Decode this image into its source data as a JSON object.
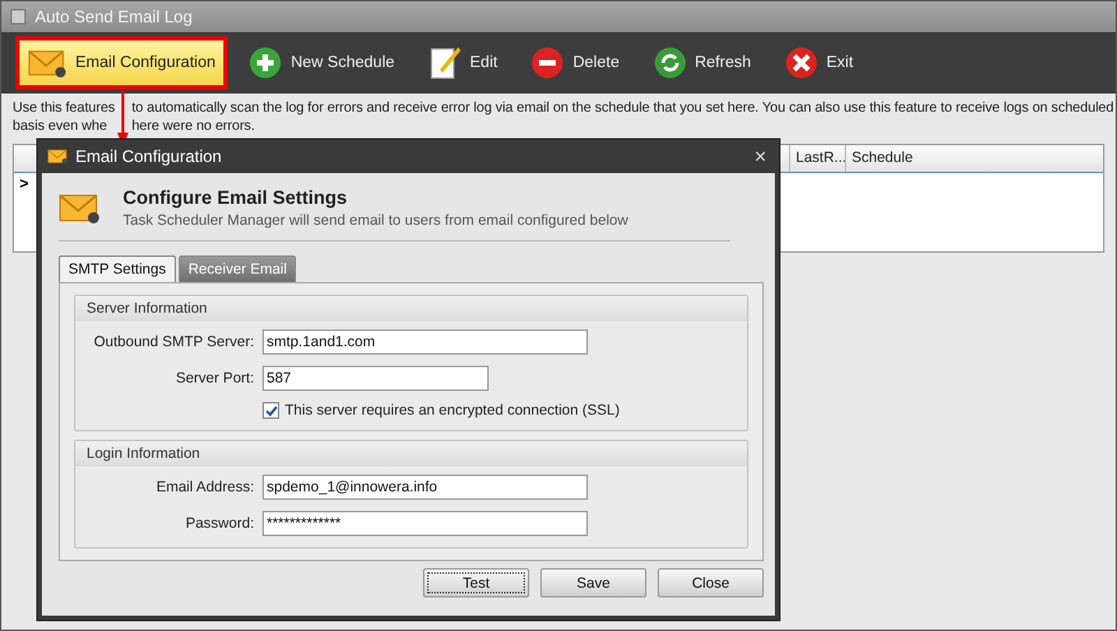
{
  "window": {
    "title": "Auto Send Email Log"
  },
  "toolbar": [
    {
      "label": "Email Configuration",
      "highlighted": true
    },
    {
      "label": "New Schedule",
      "highlighted": false
    },
    {
      "label": "Edit",
      "highlighted": false
    },
    {
      "label": "Delete",
      "highlighted": false
    },
    {
      "label": "Refresh",
      "highlighted": false
    },
    {
      "label": "Exit",
      "highlighted": false
    }
  ],
  "description": [
    [
      "Use this features",
      "to automatically scan the log for errors and receive error log via email on the schedule that you set here.  You can also use this feature to receive logs on scheduled"
    ],
    [
      "basis even whe",
      "here were no errors."
    ]
  ],
  "grid": {
    "columns": [
      "LastR...",
      "Schedule"
    ],
    "row_marker": ">"
  },
  "dialog": {
    "title": "Email Configuration",
    "close": "×",
    "heading": "Configure Email Settings",
    "subtitle": "Task Scheduler Manager will send email to users from email configured below",
    "tabs": [
      {
        "label": "SMTP Settings",
        "selected": true
      },
      {
        "label": "Receiver Email",
        "selected": false
      }
    ],
    "groups": [
      {
        "title": "Server Information",
        "fields": [
          {
            "label": "Outbound SMTP Server:",
            "value": "smtp.1and1.com",
            "kind": "wide"
          },
          {
            "label": "Server Port:",
            "value": "587",
            "kind": "short"
          }
        ],
        "checkbox": {
          "label": "This server requires an encrypted connection (SSL)",
          "checked": true
        }
      },
      {
        "title": "Login Information",
        "fields": [
          {
            "label": "Email Address:",
            "value": "spdemo_1@innowera.info",
            "kind": "wide"
          },
          {
            "label": "Password:",
            "value": "*************",
            "kind": "wide"
          }
        ]
      }
    ],
    "buttons": [
      {
        "label": "Test",
        "focused": true
      },
      {
        "label": "Save",
        "focused": false
      },
      {
        "label": "Close",
        "focused": false
      }
    ]
  }
}
